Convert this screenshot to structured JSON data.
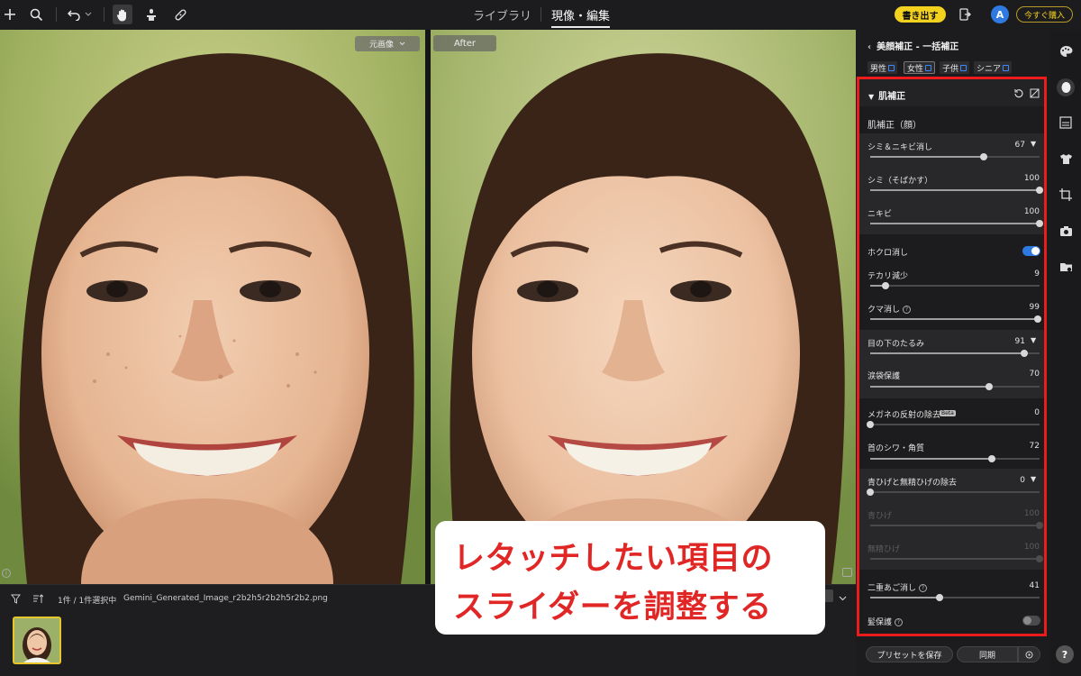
{
  "topbar": {
    "tabs": [
      {
        "label": "ライブラリ"
      },
      {
        "label": "現像・編集"
      }
    ],
    "export_label": "書き出す",
    "avatar_letter": "A",
    "buy_label": "今すぐ購入"
  },
  "viewer": {
    "before_label": "元画像",
    "after_label": "After"
  },
  "filmstrip": {
    "count_text": "1件 / 1件選択中",
    "filename": "Gemini_Generated_Image_r2b2h5r2b2h5r2b2.png"
  },
  "overlay_note": {
    "line1": "レタッチしたい項目の",
    "line2": "スライダーを調整する"
  },
  "panel": {
    "header": "美顔補正 - 一括補正",
    "chips": [
      {
        "label": "男性"
      },
      {
        "label": "女性"
      },
      {
        "label": "子供"
      },
      {
        "label": "シニア"
      }
    ],
    "section_title": "肌補正",
    "subsection_title": "肌補正（顔）",
    "sliders": {
      "spots_acne": {
        "label": "シミ＆ニキビ消し",
        "value": "67",
        "fraction": 0.67
      },
      "spots": {
        "label": "シミ（そばかす）",
        "value": "100",
        "fraction": 1.0
      },
      "acne": {
        "label": "ニキビ",
        "value": "100",
        "fraction": 1.0
      },
      "shine": {
        "label": "テカリ減少",
        "value": "9",
        "fraction": 0.09
      },
      "dark_circles": {
        "label": "クマ消し",
        "value": "99",
        "fraction": 0.99
      },
      "under_eye": {
        "label": "目の下のたるみ",
        "value": "91",
        "fraction": 0.91
      },
      "tear_bag": {
        "label": "涙袋保護",
        "value": "70",
        "fraction": 0.7
      },
      "glasses": {
        "label": "メガネの反射の除去",
        "value": "0",
        "fraction": 0.0
      },
      "neck": {
        "label": "首のシワ・角質",
        "value": "72",
        "fraction": 0.72
      },
      "beard": {
        "label": "青ひげと無精ひげの除去",
        "value": "0",
        "fraction": 0.0
      },
      "blue_beard": {
        "label": "青ひげ",
        "value": "100",
        "fraction": 1.0
      },
      "stubble": {
        "label": "無精ひげ",
        "value": "100",
        "fraction": 1.0
      },
      "double_chin": {
        "label": "二重あご消し",
        "value": "41",
        "fraction": 0.41
      }
    },
    "mole_label": "ホクロ消し",
    "mole_on": true,
    "beta_label": "Beta",
    "hair_protect_label": "髪保護",
    "hair_protect_on": false,
    "save_preset_label": "プリセットを保存",
    "sync_label": "同期"
  },
  "colors": {
    "accent_yellow": "#f3d11f",
    "toggle_blue": "#2f7ae0",
    "annotation_red": "#e12626"
  }
}
